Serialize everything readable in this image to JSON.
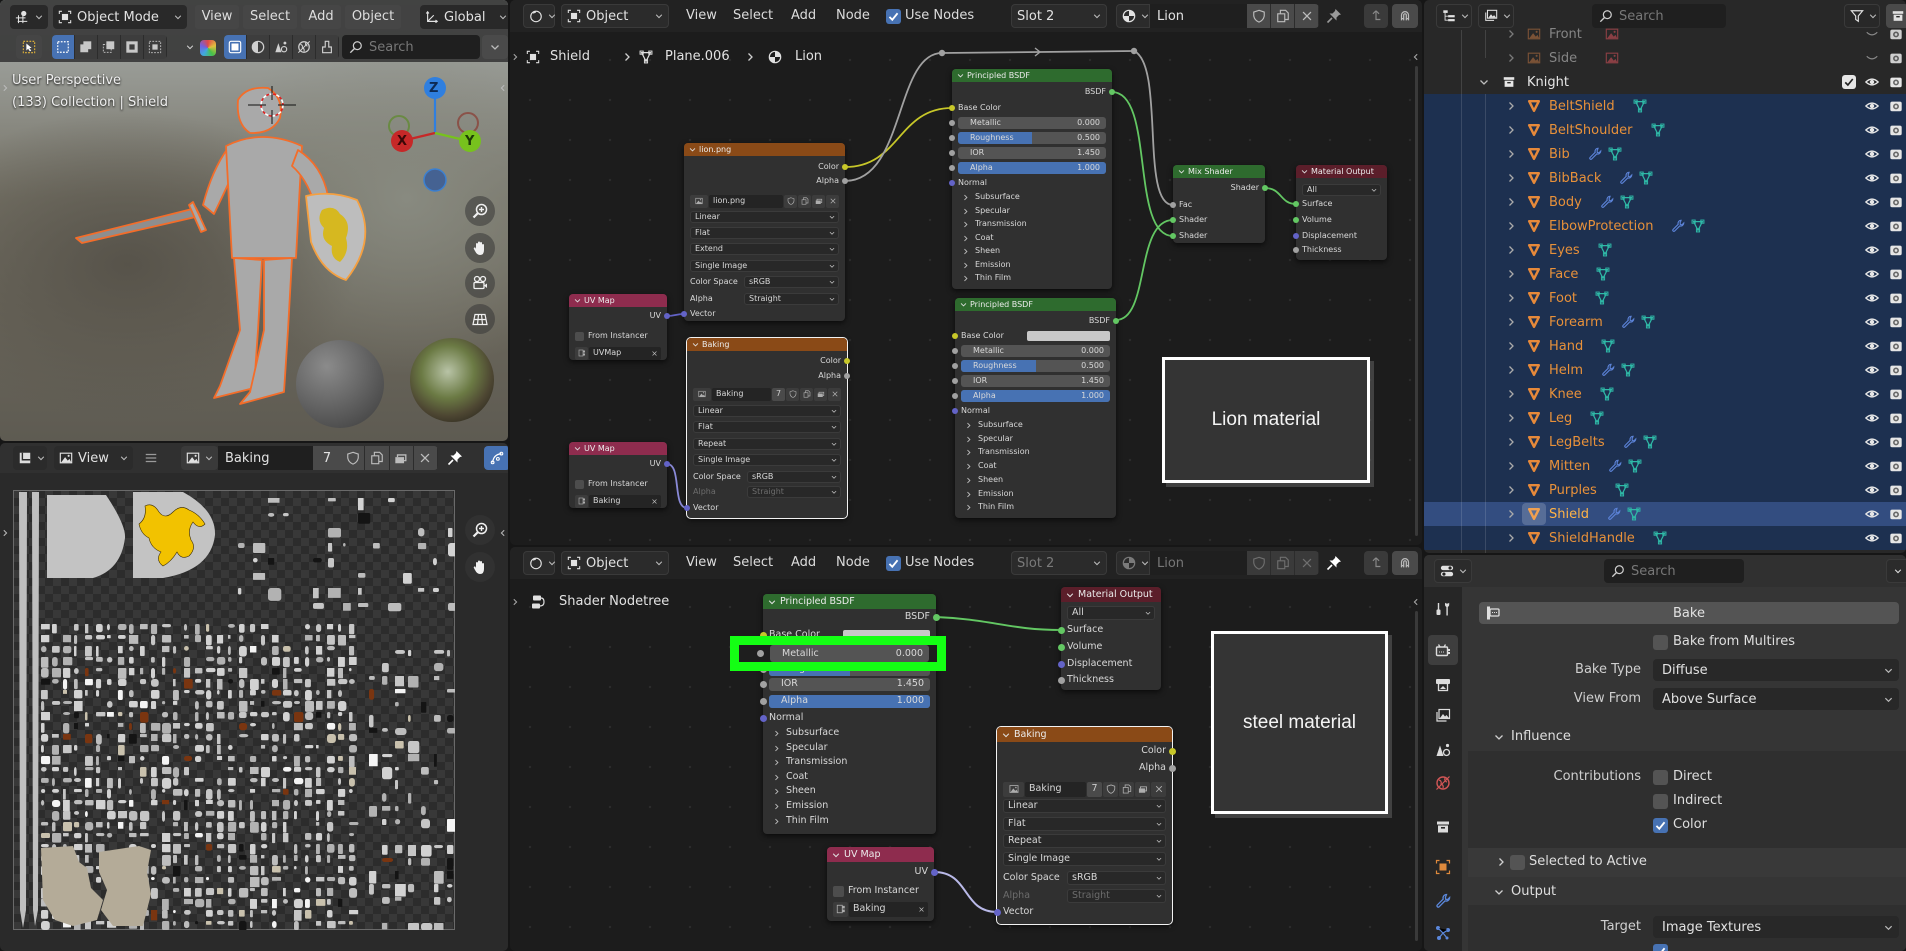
{
  "theme": {
    "accent": "#4772b3",
    "selection_outline": "#f36d2a",
    "outliner_selected_row": "#1d3050",
    "outliner_active_row": "#334d80",
    "object_name": "#e8913a",
    "highlight_box": "#14ff14"
  },
  "viewport3d": {
    "header": {
      "mode": "Object Mode",
      "menus": {
        "view": "View",
        "select": "Select",
        "add": "Add",
        "object": "Object"
      },
      "orientation": "Global",
      "search_placeholder": "Search"
    },
    "overlay": {
      "perspective": "User Perspective",
      "info": "(133) Collection | Shield"
    },
    "gizmo": {
      "x": "X",
      "y": "Y",
      "z": "Z"
    }
  },
  "image_editor": {
    "view_menu": "View",
    "image_name": "Baking",
    "image_users": "7"
  },
  "node_editor_top": {
    "header": {
      "object": "Object",
      "view": "View",
      "select": "Select",
      "add": "Add",
      "node": "Node",
      "use_nodes_label": "Use Nodes",
      "use_nodes": true,
      "slot": "Slot 2",
      "material": "Lion"
    },
    "breadcrumb": {
      "object": "Shield",
      "mesh": "Plane.006",
      "material": "Lion"
    },
    "frame_label": "Lion material",
    "nodes": {
      "lion_texture": {
        "title": "lion.png",
        "outputs": [
          "Color",
          "Alpha"
        ],
        "image": "lion.png",
        "interpolation": "Linear",
        "projection": "Flat",
        "extension": "Extend",
        "source": "Single Image",
        "color_space_label": "Color Space",
        "color_space": "sRGB",
        "alpha_label": "Alpha",
        "alpha_mode": "Straight",
        "input": "Vector"
      },
      "uv_map_1": {
        "title": "UV Map",
        "output": "UV",
        "from_instancer": "From Instancer",
        "uv_map": "UVMap"
      },
      "baking_texture": {
        "title": "Baking",
        "outputs": [
          "Color",
          "Alpha"
        ],
        "image": "Baking",
        "users": "7",
        "interpolation": "Linear",
        "projection": "Flat",
        "extension": "Repeat",
        "source": "Single Image",
        "color_space_label": "Color Space",
        "color_space": "sRGB",
        "alpha_label": "Alpha",
        "alpha_mode": "Straight",
        "input": "Vector"
      },
      "uv_map_2": {
        "title": "UV Map",
        "output": "UV",
        "from_instancer": "From Instancer",
        "uv_map": "Baking"
      },
      "bsdf_1": {
        "title": "Principled BSDF",
        "output": "BSDF",
        "base_color": "Base Color",
        "metallic": {
          "label": "Metallic",
          "value": "0.000",
          "fraction": 0
        },
        "roughness": {
          "label": "Roughness",
          "value": "0.500",
          "fraction": 0.5
        },
        "ior": {
          "label": "IOR",
          "value": "1.450"
        },
        "alpha": {
          "label": "Alpha",
          "value": "1.000",
          "fraction": 1
        },
        "normal": "Normal",
        "panels": [
          "Subsurface",
          "Specular",
          "Transmission",
          "Coat",
          "Sheen",
          "Emission",
          "Thin Film"
        ]
      },
      "bsdf_2": {
        "title": "Principled BSDF",
        "output": "BSDF",
        "base_color": "Base Color",
        "base_color_swatch": "#c8c8c8",
        "metallic": {
          "label": "Metallic",
          "value": "0.000",
          "fraction": 0
        },
        "roughness": {
          "label": "Roughness",
          "value": "0.500",
          "fraction": 0.5
        },
        "ior": {
          "label": "IOR",
          "value": "1.450"
        },
        "alpha": {
          "label": "Alpha",
          "value": "1.000",
          "fraction": 1
        },
        "normal": "Normal",
        "panels": [
          "Subsurface",
          "Specular",
          "Transmission",
          "Coat",
          "Sheen",
          "Emission",
          "Thin Film"
        ]
      },
      "mix_shader": {
        "title": "Mix Shader",
        "output": "Shader",
        "inputs": [
          "Fac",
          "Shader",
          "Shader"
        ]
      },
      "material_output": {
        "title": "Material Output",
        "target": "All",
        "inputs": [
          "Surface",
          "Volume",
          "Displacement",
          "Thickness"
        ]
      }
    }
  },
  "node_editor_bottom": {
    "header": {
      "object": "Object",
      "view": "View",
      "select": "Select",
      "add": "Add",
      "node": "Node",
      "use_nodes_label": "Use Nodes",
      "use_nodes": true,
      "slot": "Slot 2",
      "material": "Lion"
    },
    "breadcrumb": "Shader Nodetree",
    "frame_label": "steel material",
    "nodes": {
      "bsdf": {
        "title": "Principled BSDF",
        "output": "BSDF",
        "base_color": "Base Color",
        "base_color_swatch": "#c8c8c8",
        "metallic": {
          "label": "Metallic",
          "value": "0.000",
          "fraction": 0
        },
        "roughness": {
          "label": "Roughness",
          "fraction": 0.5
        },
        "ior": {
          "label": "IOR",
          "value": "1.450"
        },
        "alpha": {
          "label": "Alpha",
          "value": "1.000",
          "fraction": 1
        },
        "normal": "Normal",
        "panels": [
          "Subsurface",
          "Specular",
          "Transmission",
          "Coat",
          "Sheen",
          "Emission",
          "Thin Film"
        ]
      },
      "material_output": {
        "title": "Material Output",
        "target": "All",
        "inputs": [
          "Surface",
          "Volume",
          "Displacement",
          "Thickness"
        ]
      },
      "baking_texture": {
        "title": "Baking",
        "outputs": [
          "Color",
          "Alpha"
        ],
        "image": "Baking",
        "users": "7",
        "interpolation": "Linear",
        "projection": "Flat",
        "extension": "Repeat",
        "source": "Single Image",
        "color_space_label": "Color Space",
        "color_space": "sRGB",
        "alpha_label": "Alpha",
        "alpha_mode": "Straight",
        "input": "Vector"
      },
      "uv_map": {
        "title": "UV Map",
        "output": "UV",
        "from_instancer": "From Instancer",
        "uv_map": "Baking"
      }
    },
    "highlighted_socket": {
      "label": "Metallic",
      "value": "0.000"
    }
  },
  "outliner": {
    "search_placeholder": "Search",
    "items": [
      {
        "name": "Front",
        "type": "image",
        "disabled": true
      },
      {
        "name": "Side",
        "type": "image",
        "disabled": true
      },
      {
        "name": "Knight",
        "type": "collection",
        "enabled": true
      },
      {
        "name": "BeltShield",
        "type": "mesh",
        "modifiers": false
      },
      {
        "name": "BeltShoulder",
        "type": "mesh",
        "modifiers": false
      },
      {
        "name": "Bib",
        "type": "mesh",
        "modifiers": true
      },
      {
        "name": "BibBack",
        "type": "mesh",
        "modifiers": true
      },
      {
        "name": "Body",
        "type": "mesh",
        "modifiers": true
      },
      {
        "name": "ElbowProtection",
        "type": "mesh",
        "modifiers": true
      },
      {
        "name": "Eyes",
        "type": "mesh",
        "modifiers": false
      },
      {
        "name": "Face",
        "type": "mesh",
        "modifiers": false
      },
      {
        "name": "Foot",
        "type": "mesh",
        "modifiers": false
      },
      {
        "name": "Forearm",
        "type": "mesh",
        "modifiers": true
      },
      {
        "name": "Hand",
        "type": "mesh",
        "modifiers": false
      },
      {
        "name": "Helm",
        "type": "mesh",
        "modifiers": true
      },
      {
        "name": "Knee",
        "type": "mesh",
        "modifiers": false
      },
      {
        "name": "Leg",
        "type": "mesh",
        "modifiers": false
      },
      {
        "name": "LegBelts",
        "type": "mesh",
        "modifiers": true
      },
      {
        "name": "Mitten",
        "type": "mesh",
        "modifiers": true
      },
      {
        "name": "Purples",
        "type": "mesh",
        "modifiers": false
      },
      {
        "name": "Shield",
        "type": "mesh",
        "modifiers": true,
        "active": true
      },
      {
        "name": "ShieldHandle",
        "type": "mesh",
        "modifiers": false
      }
    ]
  },
  "properties": {
    "search_placeholder": "Search",
    "tabs": [
      "tool-icon",
      "render-icon",
      "output-icon",
      "view-layer-icon",
      "scene-icon",
      "world-icon",
      "collection-icon",
      "object-icon",
      "modifiers-icon",
      "particles-icon"
    ],
    "active_tab": "render-icon",
    "bake_button": "Bake",
    "bake_from_multires": {
      "label": "Bake from Multires",
      "checked": false
    },
    "bake_type": {
      "label": "Bake Type",
      "value": "Diffuse"
    },
    "view_from": {
      "label": "View From",
      "value": "Above Surface"
    },
    "influence": {
      "title": "Influence",
      "contributions_label": "Contributions",
      "direct": {
        "label": "Direct",
        "checked": false
      },
      "indirect": {
        "label": "Indirect",
        "checked": false
      },
      "color": {
        "label": "Color",
        "checked": true
      }
    },
    "selected_to_active": {
      "label": "Selected to Active",
      "checked": false
    },
    "output": {
      "title": "Output",
      "target_label": "Target",
      "target": "Image Textures",
      "next_checked": true
    }
  }
}
